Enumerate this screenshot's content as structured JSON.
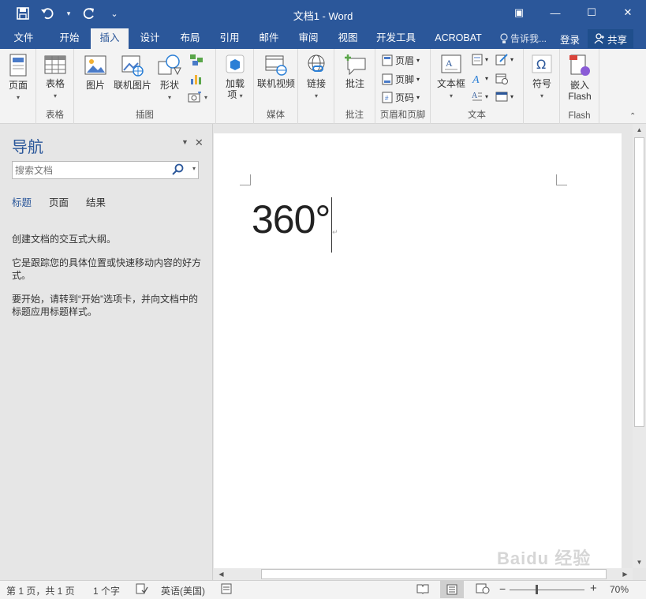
{
  "window": {
    "title": "文档1 - Word",
    "controls": {
      "ribbon_display": "▣",
      "minimize": "—",
      "maximize": "☐",
      "close": "✕"
    }
  },
  "qat": {
    "customize": "⌄"
  },
  "tabs": [
    {
      "label": "文件"
    },
    {
      "label": "开始"
    },
    {
      "label": "插入"
    },
    {
      "label": "设计"
    },
    {
      "label": "布局"
    },
    {
      "label": "引用"
    },
    {
      "label": "邮件"
    },
    {
      "label": "审阅"
    },
    {
      "label": "视图"
    },
    {
      "label": "开发工具"
    },
    {
      "label": "ACROBAT"
    }
  ],
  "active_tab": "插入",
  "tell_me": "告诉我...",
  "login": "登录",
  "share": "共享",
  "ribbon": {
    "pages": {
      "label": "页面",
      "group": ""
    },
    "tables": {
      "label": "表格",
      "group": "表格"
    },
    "illustrations": {
      "group": "插图",
      "picture": "图片",
      "online_picture": "联机图片",
      "shapes": "形状"
    },
    "addins": {
      "label1": "加载",
      "label2": "项",
      "group": ""
    },
    "media": {
      "online_video": "联机视频",
      "group": "媒体"
    },
    "links": {
      "label": "链接",
      "group": ""
    },
    "comments": {
      "label": "批注",
      "group": "批注"
    },
    "header_footer": {
      "header": "页眉",
      "footer": "页脚",
      "page_number": "页码",
      "group": "页眉和页脚"
    },
    "text": {
      "textbox": "文本框",
      "group": "文本"
    },
    "symbols": {
      "label": "符号",
      "group": ""
    },
    "flash": {
      "label1": "嵌入",
      "label2": "Flash",
      "group": "Flash"
    }
  },
  "nav": {
    "title": "导航",
    "search_placeholder": "搜索文档",
    "tabs": [
      "标题",
      "页面",
      "结果"
    ],
    "active_tab": "标题",
    "messages": [
      "创建文档的交互式大纲。",
      "它是跟踪您的具体位置或快速移动内容的好方式。",
      "要开始，请转到“开始”选项卡，并向文档中的标题应用标题样式。"
    ]
  },
  "document": {
    "content": "360°",
    "paragraph_mark": "↵"
  },
  "statusbar": {
    "page": "第 1 页，共 1 页",
    "words": "1 个字",
    "language": "英语(美国)",
    "zoom": "70%",
    "zoom_minus": "−",
    "zoom_plus": "+"
  },
  "watermark": "Baidu 经验",
  "colors": {
    "accent": "#2b579a",
    "ribbon_bg": "#f3f3f3",
    "pane_bg": "#e6e6e6"
  }
}
